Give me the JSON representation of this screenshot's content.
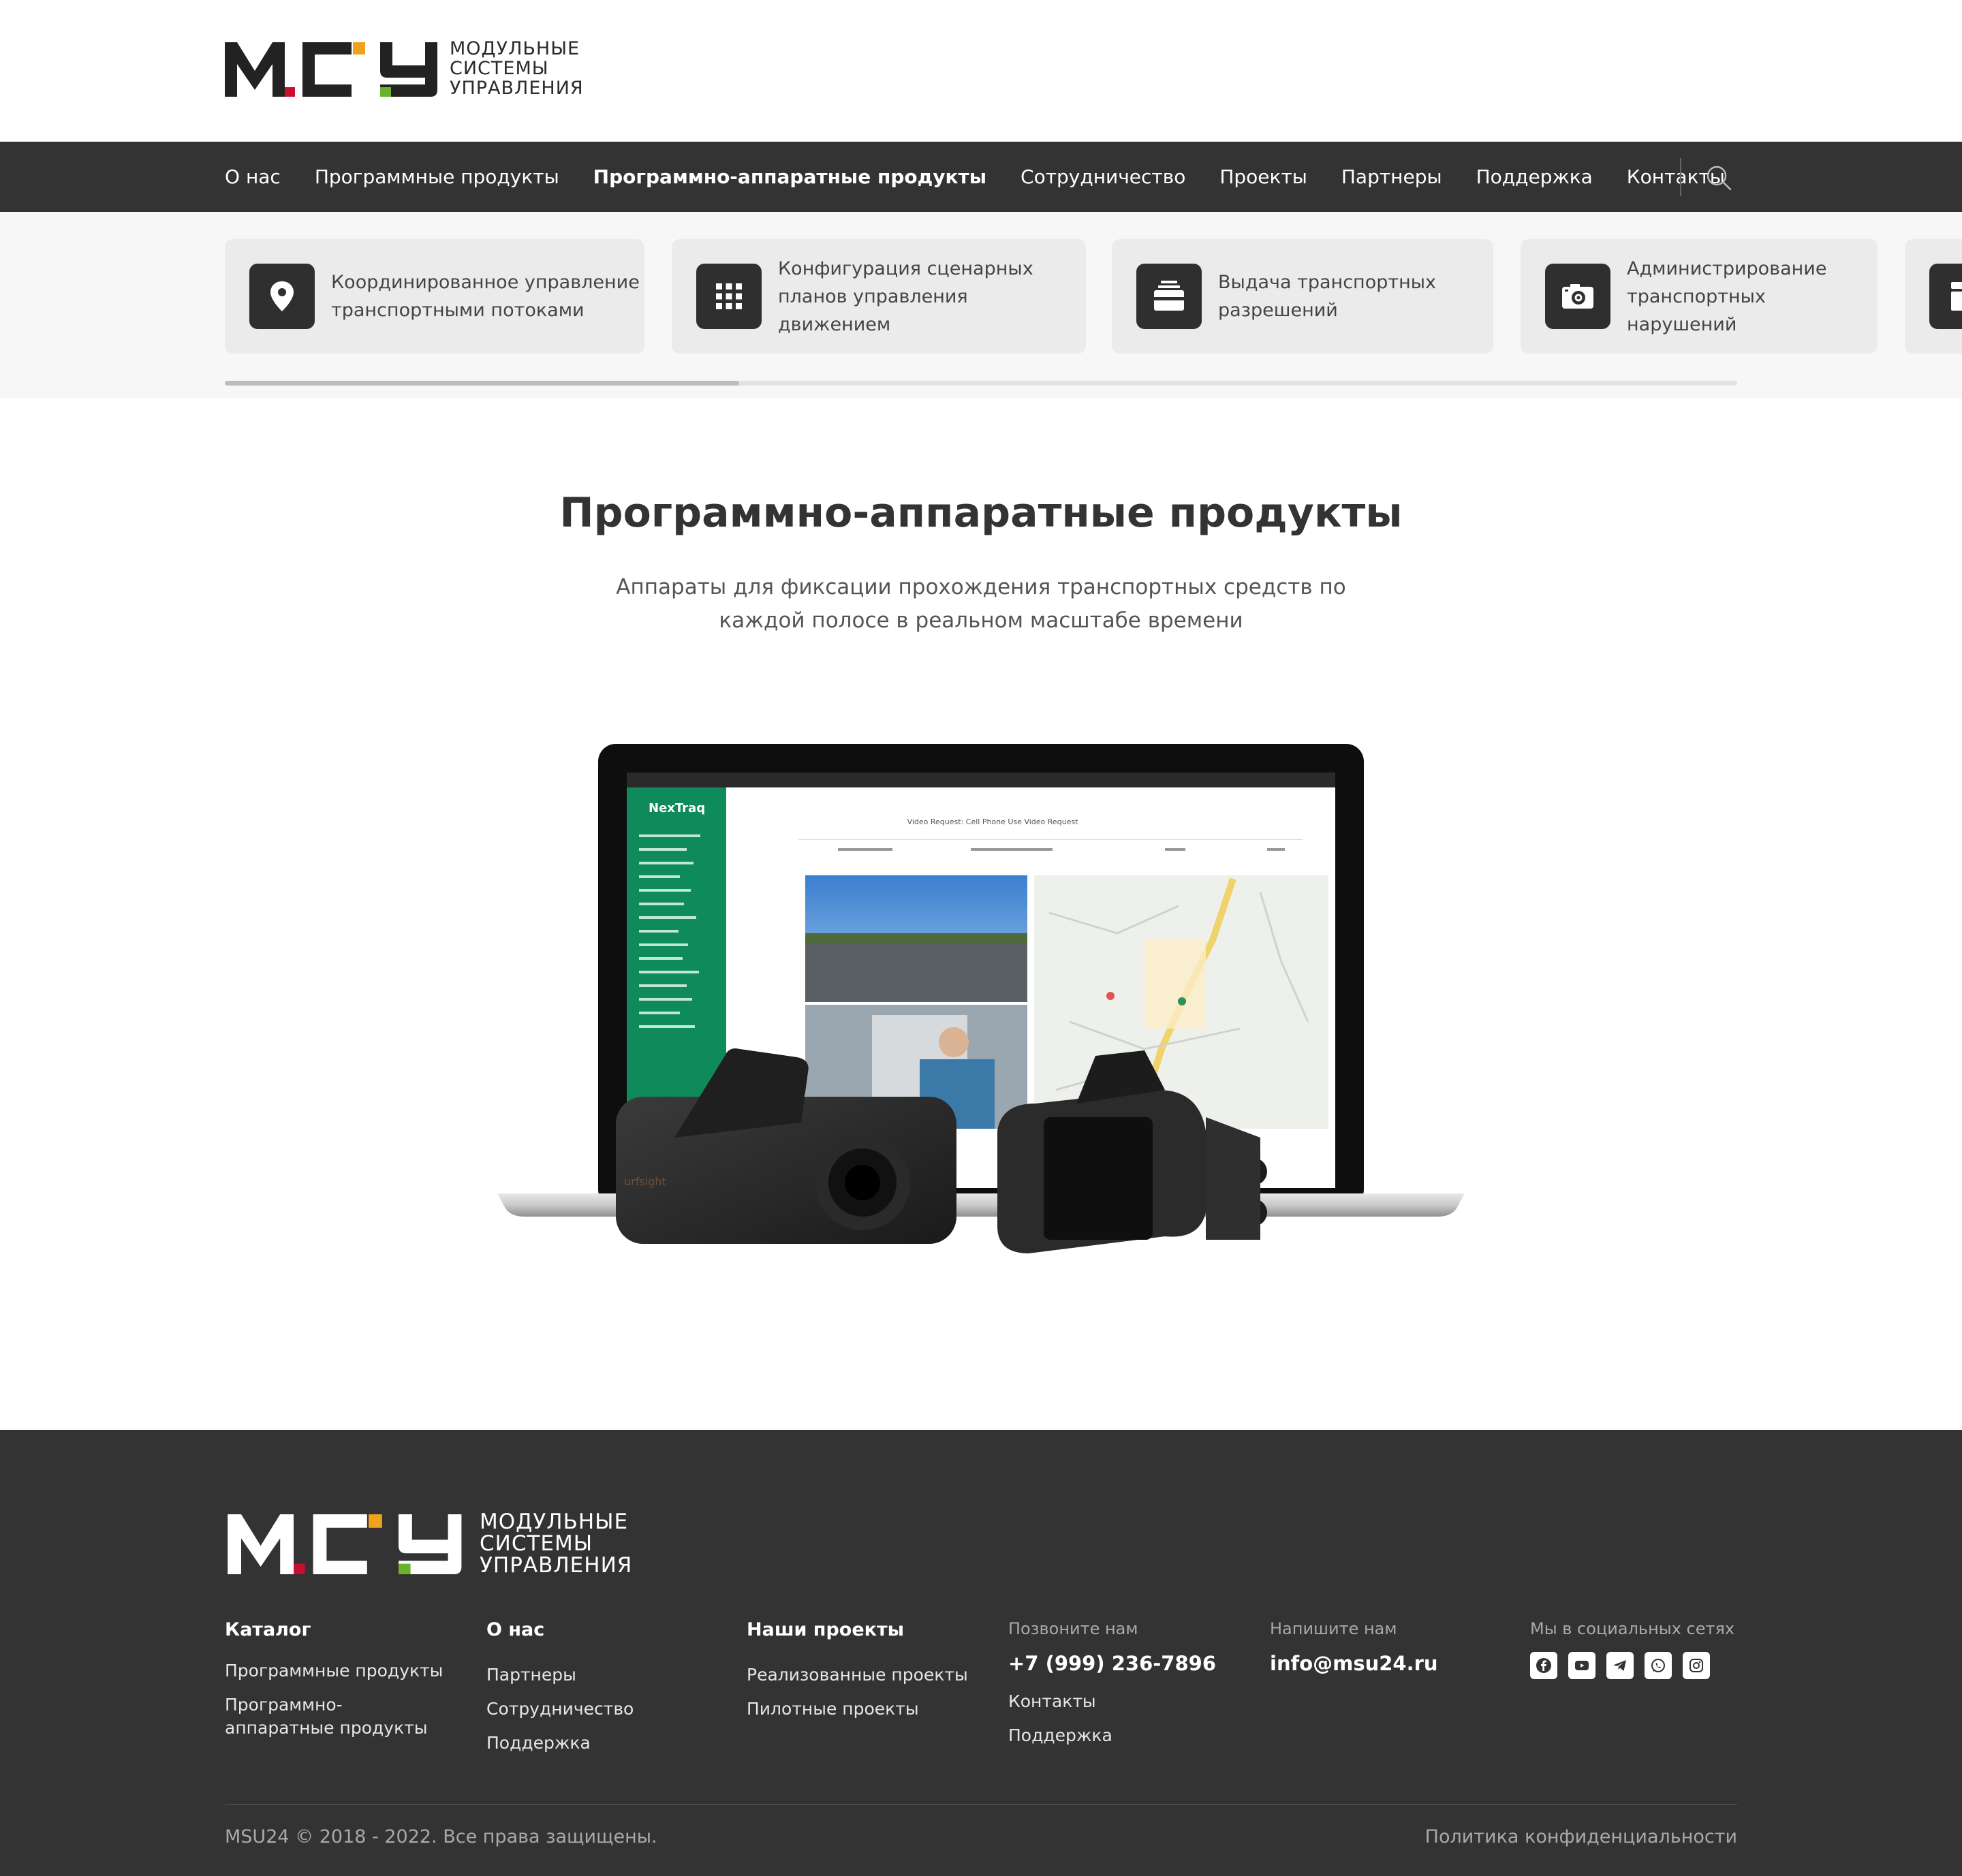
{
  "brand": {
    "logo_lines": [
      "МОДУЛЬНЫЕ",
      "СИСТЕМЫ",
      "УПРАВЛЕНИЯ"
    ],
    "colors": {
      "dark": "#222222",
      "red": "#c8102e",
      "orange": "#f0a21c",
      "green": "#6ab42d"
    }
  },
  "nav": {
    "items": [
      "О нас",
      "Программные продукты",
      "Программно-аппаратные продукты",
      "Сотрудничество",
      "Проекты",
      "Партнеры",
      "Поддержка",
      "Контакты"
    ],
    "active": "Программно-аппаратные продукты",
    "search_icon": "search-icon"
  },
  "categories": [
    {
      "label": "Координированное управление транспортными потоками",
      "icon": "location-pin-icon"
    },
    {
      "label": "Конфигурация сценарных планов управления движением",
      "icon": "grid-icon"
    },
    {
      "label": "Выдача транспортных разрешений",
      "icon": "permit-card-icon"
    },
    {
      "label": "Администрирование транспортных нарушений",
      "icon": "camera-icon"
    },
    {
      "label": "",
      "icon": "partial-card-icon"
    }
  ],
  "slider": {
    "position_fraction": 0.34
  },
  "main": {
    "title": "Программно-аппаратные продукты",
    "subtitle": "Аппараты для фиксации прохождения транспортных средств по каждой полосе в реальном масштабе времени",
    "hero": {
      "laptop_app_brand": "NexTraq",
      "laptop_screen_heading": "Video Request: Cell Phone Use Video Request",
      "camera_brand": "urfsight"
    }
  },
  "footer": {
    "col_catalog": {
      "heading": "Каталог",
      "links": [
        "Программные продукты",
        "Программно-аппаратные продукты"
      ]
    },
    "col_about": {
      "heading": "О нас",
      "links": [
        "Партнеры",
        "Сотрудничество",
        "Поддержка"
      ]
    },
    "col_projects": {
      "heading": "Наши проекты",
      "links": [
        "Реализованные проекты",
        "Пилотные проекты"
      ]
    },
    "col_call": {
      "caption": "Позвоните нам",
      "phone": "+7 (999) 236-7896",
      "links": [
        "Контакты",
        "Поддержка"
      ]
    },
    "col_write": {
      "caption": "Напишите нам",
      "email": "info@msu24.ru"
    },
    "col_social": {
      "caption": "Мы в социальных сетях",
      "icons": [
        "facebook-icon",
        "youtube-icon",
        "telegram-icon",
        "whatsapp-icon",
        "instagram-icon"
      ]
    },
    "copyright": "MSU24 © 2018 - 2022. Все права защищены.",
    "policy": "Политика конфиденциальности"
  }
}
